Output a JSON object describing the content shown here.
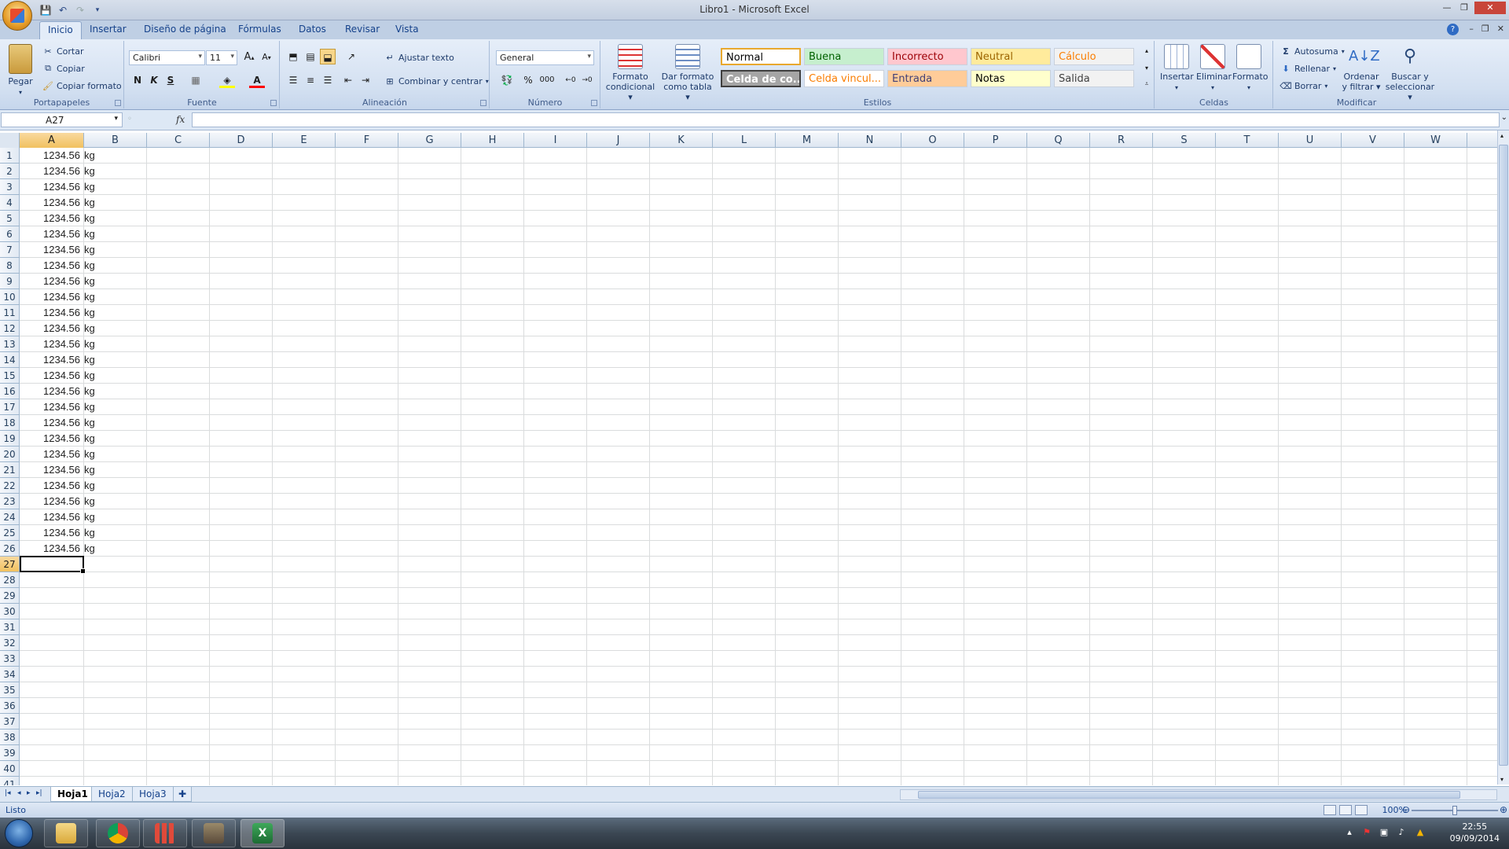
{
  "window": {
    "title": "Libro1 - Microsoft Excel"
  },
  "tabs": [
    "Inicio",
    "Insertar",
    "Diseño de página",
    "Fórmulas",
    "Datos",
    "Revisar",
    "Vista"
  ],
  "clipboard": {
    "paste": "Pegar",
    "cut": "Cortar",
    "copy": "Copiar",
    "format_painter": "Copiar formato",
    "label": "Portapapeles"
  },
  "font": {
    "name": "Calibri",
    "size": "11",
    "label": "Fuente",
    "bold": "N",
    "italic": "K",
    "underline": "S"
  },
  "alignment": {
    "wrap": "Ajustar texto",
    "merge": "Combinar y centrar",
    "label": "Alineación"
  },
  "number": {
    "format": "General",
    "label": "Número",
    "percent": "%",
    "thousands": "000"
  },
  "styles": {
    "conditional": [
      "Formato",
      "condicional"
    ],
    "as_table": [
      "Dar formato",
      "como tabla"
    ],
    "label": "Estilos",
    "cells": [
      {
        "text": "Normal",
        "bg": "#ffffff",
        "color": "#000000"
      },
      {
        "text": "Buena",
        "bg": "#c6efce",
        "color": "#006100"
      },
      {
        "text": "Incorrecto",
        "bg": "#ffc7ce",
        "color": "#9c0006"
      },
      {
        "text": "Neutral",
        "bg": "#ffeb9c",
        "color": "#9c6500"
      },
      {
        "text": "Cálculo",
        "bg": "#f2f2f2",
        "color": "#fa7d00"
      },
      {
        "text": "Celda de co...",
        "bg": "#a5a5a5",
        "color": "#ffffff"
      },
      {
        "text": "Celda vincul...",
        "bg": "#ffffff",
        "color": "#fa7d00"
      },
      {
        "text": "Entrada",
        "bg": "#ffcc99",
        "color": "#3f3f76"
      },
      {
        "text": "Notas",
        "bg": "#ffffcc",
        "color": "#000000"
      },
      {
        "text": "Salida",
        "bg": "#f2f2f2",
        "color": "#3f3f3f"
      }
    ]
  },
  "cells_group": {
    "insert": "Insertar",
    "delete": "Eliminar",
    "format": "Formato",
    "label": "Celdas"
  },
  "editing": {
    "autosum": "Autosuma",
    "fill": "Rellenar",
    "clear": "Borrar",
    "sort": [
      "Ordenar",
      "y filtrar"
    ],
    "find": [
      "Buscar y",
      "seleccionar"
    ],
    "label": "Modificar"
  },
  "formula_bar": {
    "name_box": "A27",
    "fx": "fx",
    "formula": ""
  },
  "columns": [
    "A",
    "B",
    "C",
    "D",
    "E",
    "F",
    "G",
    "H",
    "I",
    "J",
    "K",
    "L",
    "M",
    "N",
    "O",
    "P",
    "Q",
    "R",
    "S",
    "T",
    "U",
    "V",
    "W"
  ],
  "selected_column": "A",
  "selected_row": 27,
  "rows": {
    "count": 41,
    "data_rows": 26,
    "value": "1234.56",
    "unit": "kg"
  },
  "sheets": [
    "Hoja1",
    "Hoja2",
    "Hoja3"
  ],
  "active_sheet": "Hoja1",
  "status": {
    "text": "Listo",
    "zoom": "100%"
  },
  "taskbar": {
    "time": "22:55",
    "date": "09/09/2014"
  }
}
